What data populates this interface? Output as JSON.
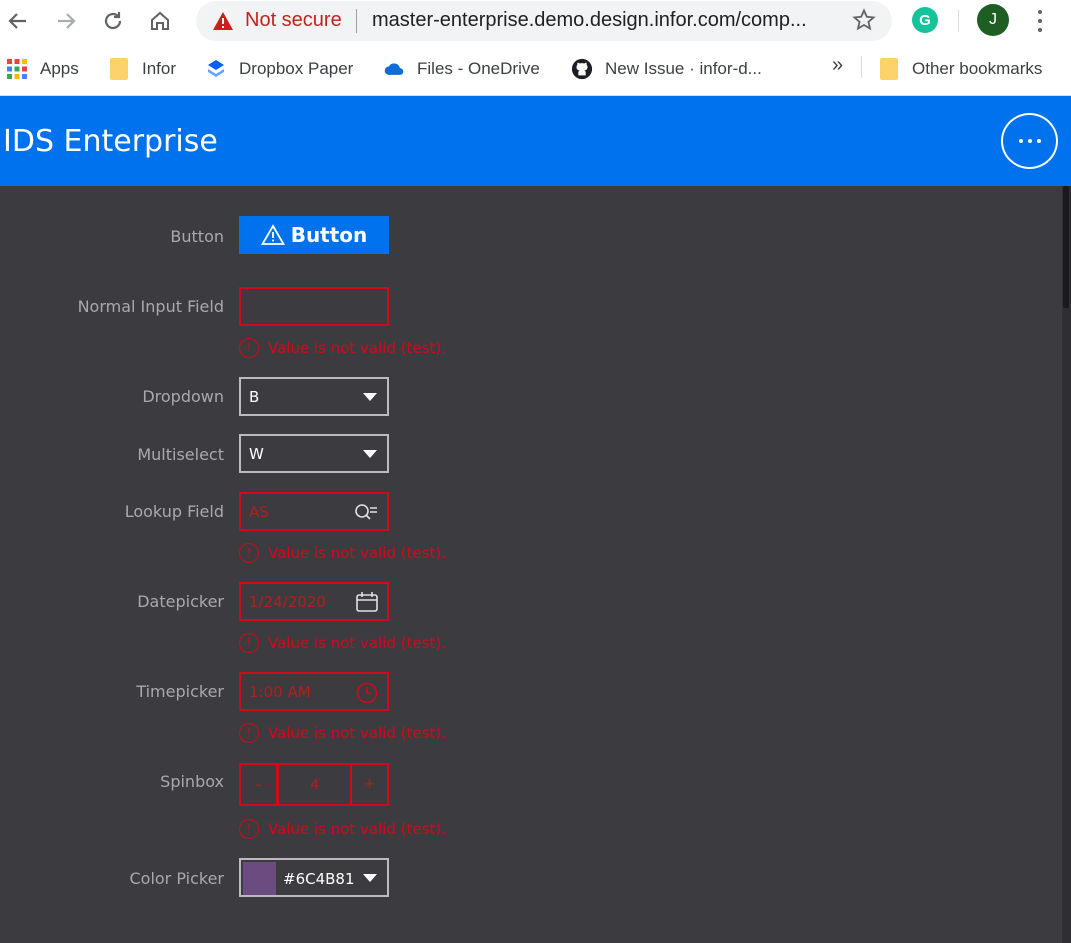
{
  "browser": {
    "security_label": "Not secure",
    "url": "master-enterprise.demo.design.infor.com/comp...",
    "grammarly_letter": "G",
    "profile_initial": "J",
    "bookmarks": [
      {
        "label": "Apps",
        "icon": "apps-grid-icon"
      },
      {
        "label": "Infor",
        "icon": "folder-icon"
      },
      {
        "label": "Dropbox Paper",
        "icon": "dropbox-icon"
      },
      {
        "label": "Files - OneDrive",
        "icon": "onedrive-cloud-icon"
      },
      {
        "label": "New Issue · infor-d...",
        "icon": "github-icon"
      }
    ],
    "overflow": "»",
    "other_bookmarks": "Other bookmarks"
  },
  "app": {
    "title": "IDS Enterprise"
  },
  "form": {
    "button": {
      "label": "Button",
      "button_text": "Button"
    },
    "normal_input": {
      "label": "Normal Input Field",
      "value": "",
      "error": "Value is not valid (test)."
    },
    "dropdown": {
      "label": "Dropdown",
      "value": "B"
    },
    "multiselect": {
      "label": "Multiselect",
      "value": "W"
    },
    "lookup": {
      "label": "Lookup Field",
      "value": "AS",
      "error": "Value is not valid (test)."
    },
    "datepicker": {
      "label": "Datepicker",
      "value": "1/24/2020",
      "error": "Value is not valid (test)."
    },
    "timepicker": {
      "label": "Timepicker",
      "value": "1:00 AM",
      "error": "Value is not valid (test)."
    },
    "spinbox": {
      "label": "Spinbox",
      "minus": "-",
      "value": "4",
      "plus": "+",
      "error": "Value is not valid (test)."
    },
    "colorpicker": {
      "label": "Color Picker",
      "value": "#6C4B81",
      "swatch_color": "#6c4b81"
    }
  },
  "colors": {
    "header": "#0072ed",
    "content_bg": "#3c3b40",
    "error": "#d2091a"
  }
}
